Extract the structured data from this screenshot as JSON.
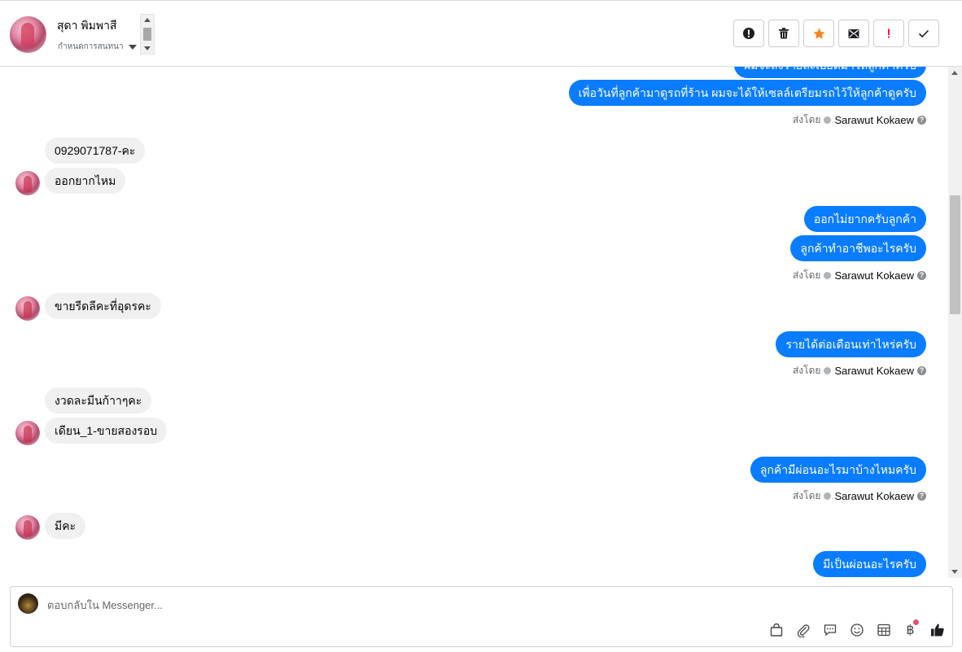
{
  "header": {
    "contact_name": "สุดา พิมพาสี",
    "assign_label": "กำหนดการสนทนา",
    "actions": [
      {
        "icon": "alert-circle-icon",
        "name": "mark-spam-button"
      },
      {
        "icon": "trash-icon",
        "name": "delete-button"
      },
      {
        "icon": "star-icon",
        "name": "star-button",
        "color": "#f5821f"
      },
      {
        "icon": "mail-unread-icon",
        "name": "mark-unread-button"
      },
      {
        "icon": "exclamation-icon",
        "name": "follow-up-button",
        "color": "#e41e3f"
      },
      {
        "icon": "check-icon",
        "name": "done-button"
      }
    ]
  },
  "messages": {
    "out_partial": "ผมจะส่งรายละเอียดมาให้ลูกค้าครับ",
    "out_1": "เพื่อวันที่ลูกค้ามาดูรถที่ร้าน ผมจะได้ให้เซลล์เตรียมรถไว้ให้ลูกค้าดูครับ",
    "in_1": "0929071787-คะ",
    "in_2": "ออกยากไหม",
    "out_2": "ออกไม่ยากครับลูกค้า",
    "out_3": "ลูกค้าทำอาชีพอะไรครับ",
    "in_3": "ขายรีดลีคะที่อุดรคะ",
    "out_4": "รายได้ต่อเดือนเท่าไหร่ครับ",
    "in_4": "งวดละมีนก้าาๆคะ",
    "in_5": "เดียน_1-ขายสองรอบ",
    "out_5": "ลูกค้ามีผ่อนอะไรมาบ้างไหมครับ",
    "in_6": "มีคะ",
    "out_6": "มีเป็นผ่อนอะไรครับ"
  },
  "sent_by": {
    "label": "ส่งโดย",
    "agent": "Sarawut Kokaew",
    "help": "?"
  },
  "composer": {
    "placeholder": "ตอบกลับใน Messenger...",
    "baht_symbol": "฿"
  },
  "colors": {
    "outgoing_bubble": "#0a7cff",
    "incoming_bubble": "#f0f0f0",
    "notification_dot": "#e84d74"
  }
}
